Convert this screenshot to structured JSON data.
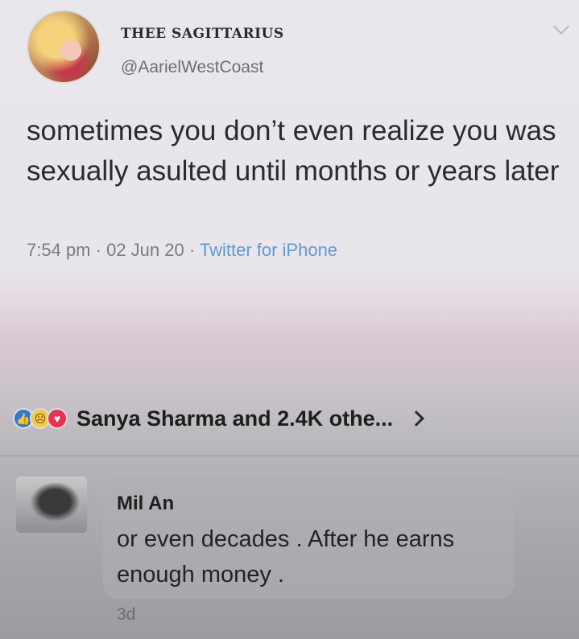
{
  "tweet": {
    "display_name": "THEE SAGITTARIUS",
    "handle": "@AarielWestCoast",
    "text": "sometimes you don’t even realize you was sexually asulted until months or years later",
    "time": "7:54 pm",
    "sep1": " · ",
    "date": "02 Jun 20",
    "sep2": " · ",
    "source": "Twitter for iPhone"
  },
  "reactions": {
    "icons": [
      "like-icon",
      "sad-icon",
      "love-icon"
    ],
    "summary": "Sanya Sharma and 2.4K othe..."
  },
  "comment": {
    "author": "Mil An",
    "text": "or even decades . After he earns enough money .",
    "time": "3d"
  },
  "colors": {
    "source_link": "#5d9bd4",
    "like": "#2e7bd6",
    "love": "#e8324e",
    "sad": "#f3c94a"
  }
}
